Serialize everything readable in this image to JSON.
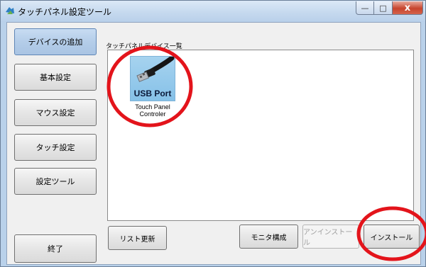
{
  "window": {
    "title": "タッチパネル設定ツール",
    "controls": {
      "minimize": "—",
      "maximize": "□",
      "close": "x"
    }
  },
  "sidebar": {
    "items": [
      {
        "label": "デバイスの追加",
        "active": true
      },
      {
        "label": "基本設定"
      },
      {
        "label": "マウス設定"
      },
      {
        "label": "タッチ設定"
      },
      {
        "label": "設定ツール"
      }
    ],
    "exit_label": "終了"
  },
  "device_list": {
    "group_label": "タッチパネルデバイス一覧",
    "items": [
      {
        "icon": "usb-cable-icon",
        "icon_caption": "USB Port",
        "name": "Touch Panel\nControler"
      }
    ]
  },
  "buttons": {
    "refresh": "リスト更新",
    "monitor": "モニタ構成",
    "uninstall": "アンインストール",
    "install": "インストール"
  },
  "colors": {
    "annotation_circle": "#e3141b",
    "active_tab": "#b4cde9",
    "device_icon_bg": "#96cbeb"
  }
}
